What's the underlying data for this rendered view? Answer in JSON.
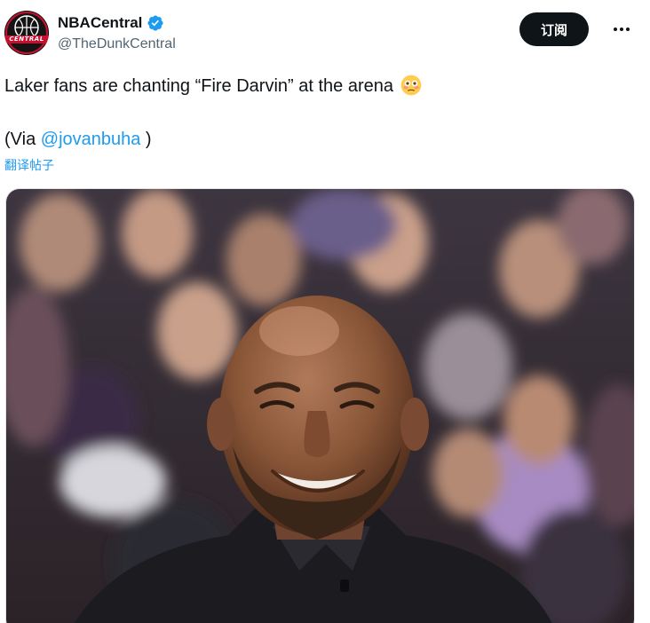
{
  "account": {
    "display_name": "NBACentral",
    "handle": "@TheDunkCentral",
    "avatar_text": "CENTRAL",
    "verified": true
  },
  "actions": {
    "subscribe_label": "订阅",
    "more_icon": "more-horizontal-icon"
  },
  "tweet": {
    "line1": "Laker fans are chanting “Fire Darvin” at the arena",
    "emoji": "flushed-face-icon",
    "line2_prefix": "(Via ",
    "mention": "@jovanbuha",
    "line2_suffix": " )",
    "translate_label": "翻译帖子"
  },
  "colors": {
    "accent": "#1d9bf0",
    "text": "#0f1419",
    "secondary": "#536471",
    "button_bg": "#0f1419",
    "avatar_red": "#c8102e"
  }
}
